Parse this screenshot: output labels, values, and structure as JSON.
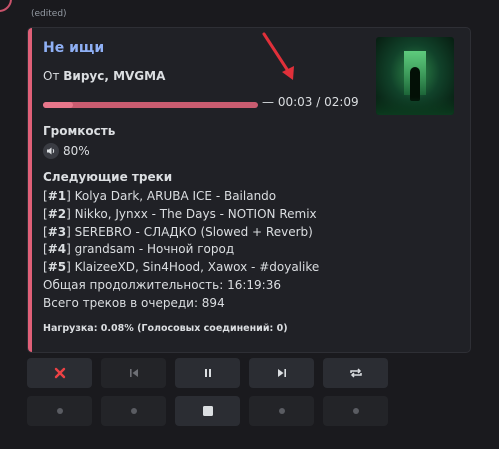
{
  "message": {
    "edited_label": "(edited)"
  },
  "embed": {
    "accent_color": "#e06078",
    "title": "Не ищи",
    "author_prefix": "От",
    "author": "Вирус, MVGMA",
    "progress_fraction": 0.14,
    "time": "— 00:03 / 02:09",
    "volume_heading": "Громкость",
    "volume_value": "80%",
    "next_heading": "Следующие треки",
    "tracks": [
      {
        "num": "#1",
        "text": "Kolya Dark, ARUBA ICE - Bailando"
      },
      {
        "num": "#2",
        "text": "Nikko, Jynxx - The Days - NOTION Remix"
      },
      {
        "num": "#3",
        "text": "SEREBRO - СЛАДКО (Slowed + Reverb)"
      },
      {
        "num": "#4",
        "text": "grandsam - Ночной город"
      },
      {
        "num": "#5",
        "text": "KlaizeeXD, Sin4Hood, Xawox - #doyalike"
      }
    ],
    "total_duration": "Общая продолжительность: 16:19:36",
    "queue_total": "Всего треков в очереди: 894",
    "load": "Нагрузка: 0.08% (Голосовых соединений: 0)"
  },
  "controls": {
    "row1": [
      {
        "name": "stop-button",
        "icon": "close-icon"
      },
      {
        "name": "previous-button",
        "icon": "skip-previous-icon"
      },
      {
        "name": "pause-button",
        "icon": "pause-icon"
      },
      {
        "name": "next-button",
        "icon": "skip-next-icon"
      },
      {
        "name": "repeat-button",
        "icon": "repeat-icon"
      }
    ],
    "row2": [
      {
        "name": "placeholder-button-1",
        "icon": "dot-icon"
      },
      {
        "name": "placeholder-button-2",
        "icon": "dot-icon"
      },
      {
        "name": "stop-square-button",
        "icon": "stop-icon"
      },
      {
        "name": "placeholder-button-3",
        "icon": "dot-icon"
      },
      {
        "name": "placeholder-button-4",
        "icon": "dot-icon"
      }
    ],
    "colors": {
      "close": "#ed4245",
      "button_bg": "#2b2d33"
    }
  },
  "annotation": {
    "arrow_color": "#e0303a"
  }
}
